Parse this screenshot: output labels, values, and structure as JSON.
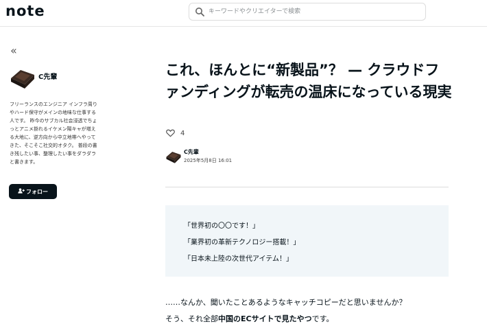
{
  "header": {
    "logo": "note",
    "search_placeholder": "キーワードやクリエイターで検索",
    "search_icon": "search-icon"
  },
  "sidebar": {
    "collapse_label": "«",
    "author_name": "C先輩",
    "bio": "フリーランスのエンジニア インフラ周りやハード保守がメインの地味な仕事する人です。 昨今のサブカル社会浸透でちょっとアニメ掛れるイケメン陽キャが増える大地に、逆方向から中立地帯へやってきた、そこそこ社交的オタク。 普段の書き残したい事、整理したい事をダラダラと書きます。",
    "follow_label": "フォロー",
    "follow_icon": "add-user-icon"
  },
  "article": {
    "title": "これ、ほんとに“新製品”？ — クラウドファンディングが転売の温床になっている現実",
    "likes": "4",
    "author": "C先輩",
    "date": "2025年5月8日 16:01",
    "quotes": [
      "「世界初の〇〇です！」",
      "「業界初の革新テクノロジー搭載！」",
      "「日本未上陸の次世代アイテム！」"
    ],
    "para1": "……なんか、聞いたことあるようなキャッチコピーだと思いませんか？",
    "para2_prefix": "そう、それ全部",
    "para2_bold": "中国のECサイトで見たやつ",
    "para2_suffix": "です。"
  }
}
